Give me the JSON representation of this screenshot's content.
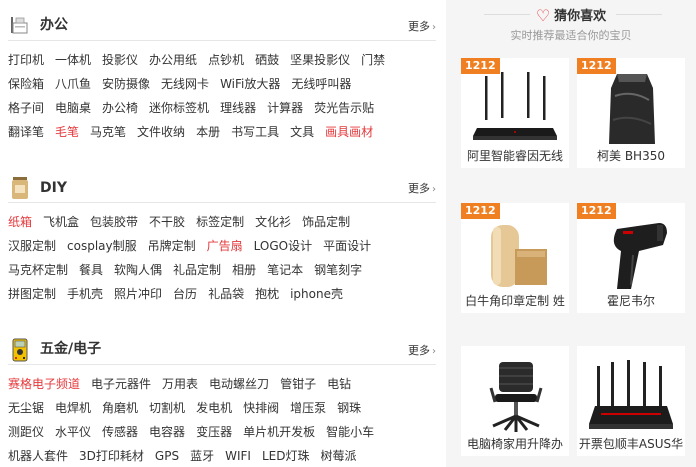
{
  "sections": [
    {
      "title": "办公",
      "more": "更多",
      "rows": [
        [
          {
            "t": "打印机"
          },
          {
            "t": "一体机"
          },
          {
            "t": "投影仪"
          },
          {
            "t": "办公用纸"
          },
          {
            "t": "点钞机"
          },
          {
            "t": "硒鼓"
          },
          {
            "t": "坚果投影仪"
          },
          {
            "t": "门禁"
          }
        ],
        [
          {
            "t": "保险箱"
          },
          {
            "t": "八爪鱼"
          },
          {
            "t": "安防摄像"
          },
          {
            "t": "无线网卡"
          },
          {
            "t": "WiFi放大器"
          },
          {
            "t": "无线呼叫器"
          }
        ],
        [
          {
            "t": "格子间"
          },
          {
            "t": "电脑桌"
          },
          {
            "t": "办公椅"
          },
          {
            "t": "迷你标签机"
          },
          {
            "t": "理线器"
          },
          {
            "t": "计算器"
          },
          {
            "t": "荧光告示贴"
          }
        ],
        [
          {
            "t": "翻译笔"
          },
          {
            "t": "毛笔",
            "hot": true
          },
          {
            "t": "马克笔"
          },
          {
            "t": "文件收纳"
          },
          {
            "t": "本册"
          },
          {
            "t": "书写工具"
          },
          {
            "t": "文具"
          },
          {
            "t": "画具画材",
            "hot": true
          }
        ]
      ]
    },
    {
      "title": "DIY",
      "more": "更多",
      "rows": [
        [
          {
            "t": "纸箱",
            "hot": true
          },
          {
            "t": "飞机盒"
          },
          {
            "t": "包装胶带"
          },
          {
            "t": "不干胶"
          },
          {
            "t": "标签定制"
          },
          {
            "t": "文化衫"
          },
          {
            "t": "饰品定制"
          }
        ],
        [
          {
            "t": "汉服定制"
          },
          {
            "t": "cosplay制服"
          },
          {
            "t": "吊牌定制"
          },
          {
            "t": "广告扇",
            "hot": true
          },
          {
            "t": "LOGO设计"
          },
          {
            "t": "平面设计"
          }
        ],
        [
          {
            "t": "马克杯定制"
          },
          {
            "t": "餐具"
          },
          {
            "t": "软陶人偶"
          },
          {
            "t": "礼品定制"
          },
          {
            "t": "相册"
          },
          {
            "t": "笔记本"
          },
          {
            "t": "钢笔刻字"
          }
        ],
        [
          {
            "t": "拼图定制"
          },
          {
            "t": "手机壳"
          },
          {
            "t": "照片冲印"
          },
          {
            "t": "台历"
          },
          {
            "t": "礼品袋"
          },
          {
            "t": "抱枕"
          },
          {
            "t": "iphone壳"
          }
        ]
      ]
    },
    {
      "title": "五金/电子",
      "more": "更多",
      "rows": [
        [
          {
            "t": "赛格电子频道",
            "hot": true
          },
          {
            "t": "电子元器件"
          },
          {
            "t": "万用表"
          },
          {
            "t": "电动螺丝刀"
          },
          {
            "t": "管钳子"
          },
          {
            "t": "电钻"
          }
        ],
        [
          {
            "t": "无尘锯"
          },
          {
            "t": "电焊机"
          },
          {
            "t": "角磨机"
          },
          {
            "t": "切割机"
          },
          {
            "t": "发电机"
          },
          {
            "t": "快排阀"
          },
          {
            "t": "增压泵"
          },
          {
            "t": "钢珠"
          }
        ],
        [
          {
            "t": "测距仪"
          },
          {
            "t": "水平仪"
          },
          {
            "t": "传感器"
          },
          {
            "t": "电容器"
          },
          {
            "t": "变压器"
          },
          {
            "t": "单片机开发板"
          },
          {
            "t": "智能小车"
          }
        ],
        [
          {
            "t": "机器人套件"
          },
          {
            "t": "3D打印耗材"
          },
          {
            "t": "GPS"
          },
          {
            "t": "蓝牙"
          },
          {
            "t": "WIFI"
          },
          {
            "t": "LED灯珠"
          },
          {
            "t": "树莓派"
          }
        ]
      ]
    }
  ],
  "guess": {
    "title": "猜你喜欢",
    "subtitle": "实时推荐最适合你的宝贝",
    "badge": "1212",
    "items": [
      {
        "name": "阿里智能睿因无线",
        "badge": true,
        "icon": "router-image"
      },
      {
        "name": "柯美 BH350",
        "badge": true,
        "icon": "toner-bag-image"
      },
      {
        "name": "白牛角印章定制 姓",
        "badge": true,
        "icon": "stamp-image"
      },
      {
        "name": "霍尼韦尔",
        "badge": true,
        "icon": "barcode-scanner-image"
      },
      {
        "name": "电脑椅家用升降办",
        "badge": false,
        "icon": "office-chair-image"
      },
      {
        "name": "开票包顺丰ASUS华",
        "badge": false,
        "icon": "gaming-router-image"
      }
    ]
  },
  "colors": {
    "accent": "#e4393c",
    "badge": "#f07f21",
    "panel": "#f5f5f5"
  }
}
